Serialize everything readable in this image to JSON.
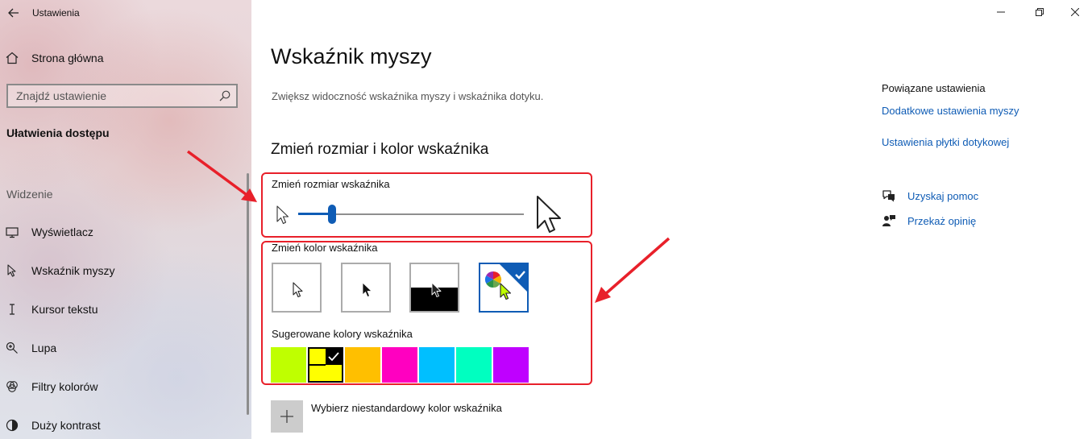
{
  "window": {
    "title": "Ustawienia",
    "controls": {
      "minimize": "minimize",
      "restore": "restore",
      "close": "close"
    }
  },
  "sidebar": {
    "home_label": "Strona główna",
    "search_placeholder": "Znajdź ustawienie",
    "section": "Ułatwienia dostępu",
    "group": "Widzenie",
    "items": [
      {
        "label": "Wyświetlacz",
        "icon": "monitor-icon"
      },
      {
        "label": "Wskaźnik myszy",
        "icon": "mouse-pointer-icon"
      },
      {
        "label": "Kursor tekstu",
        "icon": "text-cursor-icon"
      },
      {
        "label": "Lupa",
        "icon": "magnifier-icon"
      },
      {
        "label": "Filtry kolorów",
        "icon": "color-filter-icon"
      },
      {
        "label": "Duży kontrast",
        "icon": "contrast-icon"
      }
    ]
  },
  "main": {
    "title": "Wskaźnik myszy",
    "description": "Zwiększ widoczność wskaźnika myszy i wskaźnika dotyku.",
    "subtitle": "Zmień rozmiar i kolor wskaźnika",
    "size": {
      "label": "Zmień rozmiar wskaźnika",
      "value": 0.15
    },
    "color": {
      "label": "Zmień kolor wskaźnika",
      "options": [
        "white",
        "black",
        "inverted",
        "custom"
      ],
      "selected": "custom"
    },
    "suggested": {
      "label": "Sugerowane kolory wskaźnika",
      "colors": [
        "#bfff00",
        "#ffff00",
        "#ffbf00",
        "#ff00c0",
        "#00bfff",
        "#00ffc0",
        "#bf00ff"
      ],
      "selected_index": 1
    },
    "custom_color_label": "Wybierz niestandardowy kolor wskaźnika"
  },
  "related": {
    "title": "Powiązane ustawienia",
    "links": [
      "Dodatkowe ustawienia myszy",
      "Ustawienia płytki dotykowej"
    ]
  },
  "help": {
    "get_help": "Uzyskaj pomoc",
    "feedback": "Przekaż opinię"
  },
  "colors": {
    "accent": "#0f5cb5",
    "annotation": "#e8202a"
  }
}
